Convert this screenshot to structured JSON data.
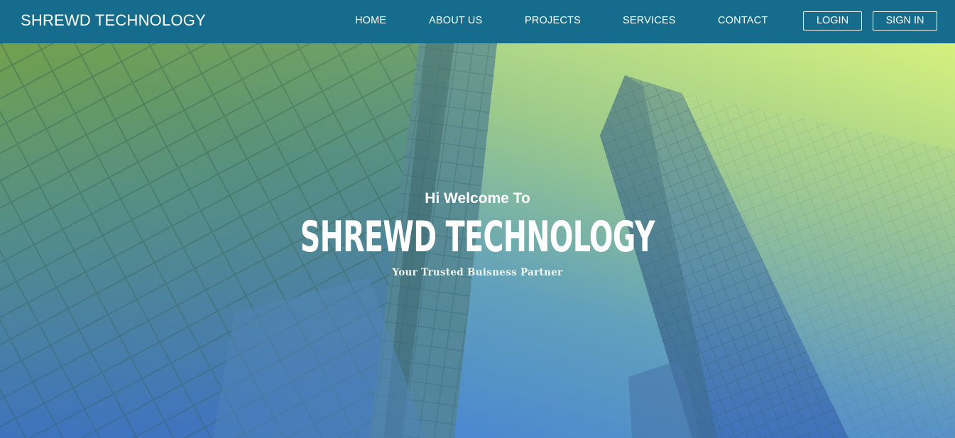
{
  "navbar": {
    "brand": "SHREWD TECHNOLOGY",
    "links": [
      {
        "label": "HOME"
      },
      {
        "label": "ABOUT US"
      },
      {
        "label": "PROJECTS"
      },
      {
        "label": "SERVICES"
      },
      {
        "label": "CONTACT"
      }
    ],
    "login_label": "LOGIN",
    "signin_label": "SIGN IN",
    "background_color": "#166c8c"
  },
  "hero": {
    "greeting": "Hi Welcome To",
    "title": "SHREWD TECHNOLOGY",
    "tagline": "Your Trusted Buisness Partner",
    "gradient_top_color": "#cfee7c",
    "gradient_bottom_color": "#3a78d8",
    "background_image": "skyscrapers-looking-up"
  }
}
